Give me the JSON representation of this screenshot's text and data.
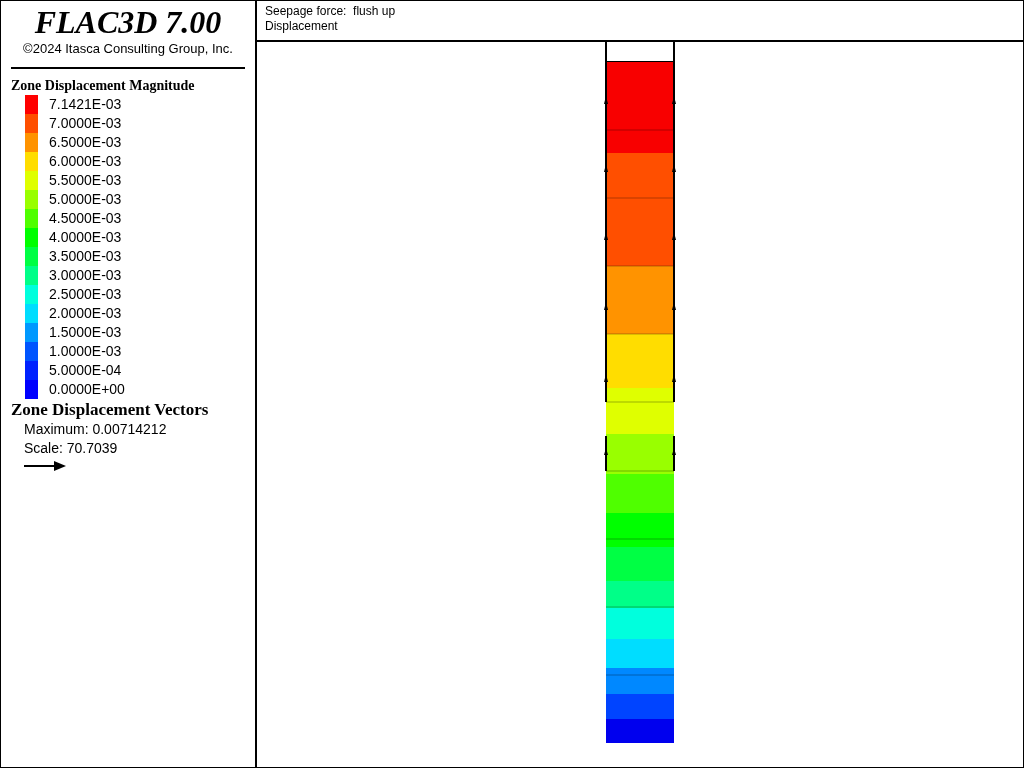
{
  "title": "FLAC3D 7.00",
  "copyright": "©2024 Itasca Consulting Group, Inc.",
  "legend": {
    "title": "Zone Displacement Magnitude",
    "items": [
      {
        "label": "7.1421E-03",
        "color": "#ff0000"
      },
      {
        "label": "7.0000E-03",
        "color": "#ff4f00"
      },
      {
        "label": "6.5000E-03",
        "color": "#ff9300"
      },
      {
        "label": "6.0000E-03",
        "color": "#ffdd00"
      },
      {
        "label": "5.5000E-03",
        "color": "#dfff00"
      },
      {
        "label": "5.0000E-03",
        "color": "#99ff00"
      },
      {
        "label": "4.5000E-03",
        "color": "#4fff00"
      },
      {
        "label": "4.0000E-03",
        "color": "#00ff00"
      },
      {
        "label": "3.5000E-03",
        "color": "#00ff44"
      },
      {
        "label": "3.0000E-03",
        "color": "#00ff88"
      },
      {
        "label": "2.5000E-03",
        "color": "#00ffdd"
      },
      {
        "label": "2.0000E-03",
        "color": "#00ddff"
      },
      {
        "label": "1.5000E-03",
        "color": "#0099ff"
      },
      {
        "label": "1.0000E-03",
        "color": "#0055ff"
      },
      {
        "label": "5.0000E-04",
        "color": "#0022ff"
      },
      {
        "label": "0.0000E+00",
        "color": "#0000ff"
      }
    ]
  },
  "vectors": {
    "title": "Zone Displacement Vectors",
    "maximum": "Maximum: 0.00714212",
    "scale": "Scale: 70.7039"
  },
  "header": {
    "line_1": "Seepage force:  flush up",
    "line_2": "Displacement"
  }
}
